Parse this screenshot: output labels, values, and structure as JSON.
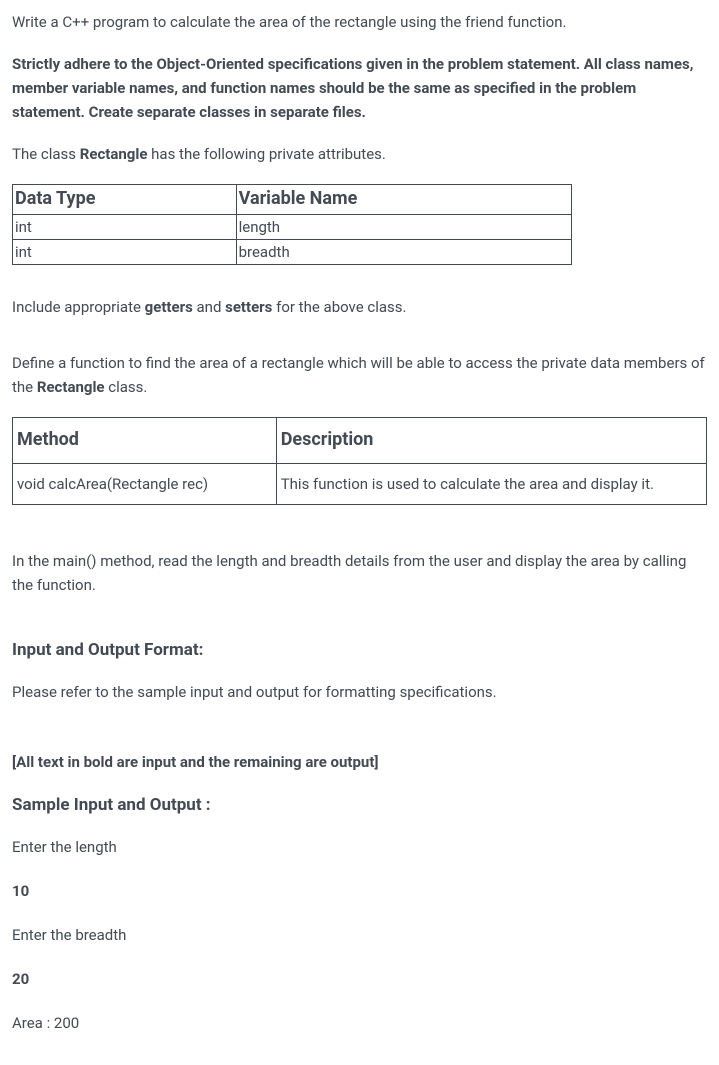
{
  "intro": {
    "line1": "Write a C++ program to calculate the area of the rectangle using the friend function.",
    "line2": "Strictly adhere to the Object-Oriented specifications given in the problem statement. All class names, member variable names, and function names should be the same as specified in the problem statement. Create separate classes in separate files.",
    "line3_prefix": "The class ",
    "line3_bold": "Rectangle",
    "line3_suffix": " has the following private attributes."
  },
  "attr_table": {
    "header": {
      "col1": "Data Type",
      "col2": "Variable Name"
    },
    "rows": [
      {
        "type": "int",
        "name": "length"
      },
      {
        "type": "int",
        "name": "breadth"
      }
    ]
  },
  "getters_setters": {
    "prefix": "Include appropriate ",
    "bold1": "getters",
    "mid": " and ",
    "bold2": "setters",
    "suffix": " for the above class."
  },
  "define_fn": {
    "prefix": "Define a function to find the area of a rectangle which will be able to access the private data members of the ",
    "bold": "Rectangle",
    "suffix": " class."
  },
  "method_table": {
    "header": {
      "col1": "Method",
      "col2": "Description"
    },
    "rows": [
      {
        "method": "void calcArea(Rectangle rec)",
        "desc": "This function is used to calculate the area and display it."
      }
    ]
  },
  "main_text": "In the main() method, read the length and breadth details from the user and display the area by calling the function.",
  "io_format": {
    "heading": "Input and Output Format:",
    "text": "Please refer to the sample input and output for formatting specifications."
  },
  "bold_note": "[All text in bold are input and the remaining are output]",
  "sample": {
    "heading": "Sample Input and Output  :",
    "lines": [
      {
        "text": "Enter the length",
        "bold": false
      },
      {
        "text": "10",
        "bold": true
      },
      {
        "text": "Enter the breadth",
        "bold": false
      },
      {
        "text": "20",
        "bold": true
      },
      {
        "text": "Area : 200",
        "bold": false
      }
    ]
  }
}
